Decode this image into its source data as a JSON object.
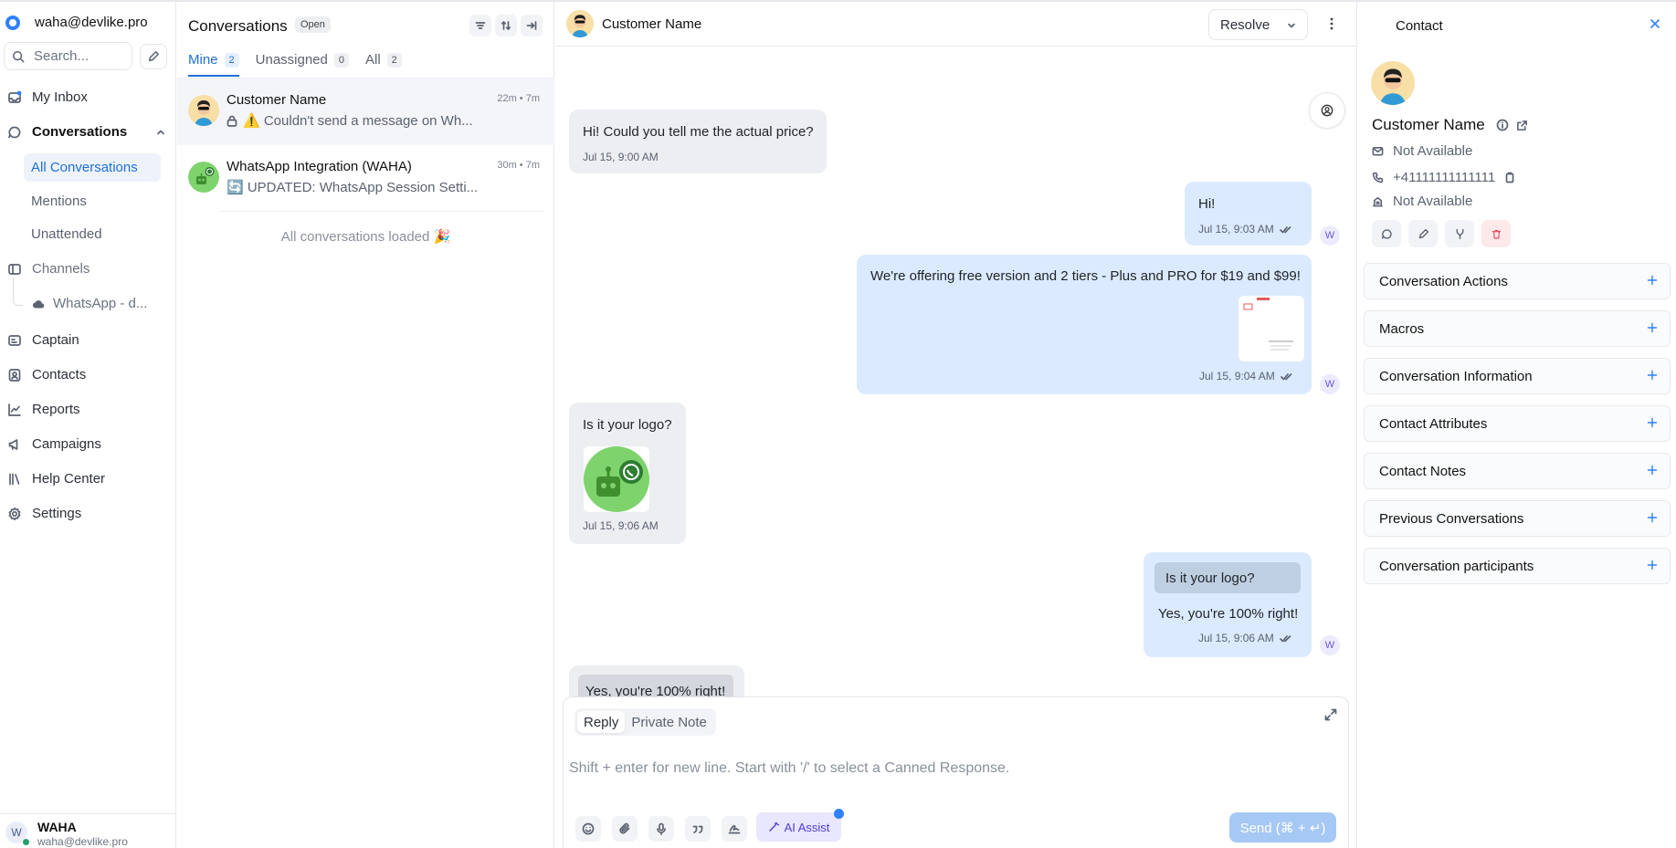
{
  "sidebar": {
    "account_name": "waha@devlike.pro",
    "search_placeholder": "Search...",
    "nav": {
      "my_inbox": "My Inbox",
      "conversations": "Conversations",
      "all_conversations": "All Conversations",
      "mentions": "Mentions",
      "unattended": "Unattended",
      "channels": "Channels",
      "channel_whatsapp": "WhatsApp - d...",
      "captain": "Captain",
      "contacts": "Contacts",
      "reports": "Reports",
      "campaigns": "Campaigns",
      "help_center": "Help Center",
      "settings": "Settings"
    },
    "user": {
      "initial": "W",
      "name": "WAHA",
      "email": "waha@devlike.pro"
    }
  },
  "conversation_list": {
    "title": "Conversations",
    "status_badge": "Open",
    "tabs": [
      {
        "label": "Mine",
        "count": "2"
      },
      {
        "label": "Unassigned",
        "count": "0"
      },
      {
        "label": "All",
        "count": "2"
      }
    ],
    "items": [
      {
        "name": "Customer Name",
        "time": "22m • 7m",
        "preview": "⚠️ Couldn't send a message on Wh..."
      },
      {
        "name": "WhatsApp Integration (WAHA)",
        "time": "30m • 7m",
        "preview": "🔄 UPDATED: WhatsApp Session Setti..."
      }
    ],
    "footer": "All conversations loaded 🎉"
  },
  "chat": {
    "contact_name": "Customer Name",
    "resolve_label": "Resolve",
    "messages": [
      {
        "text": "Hi! Could you tell me the actual price?",
        "time": "Jul 15, 9:00 AM"
      },
      {
        "text": "Hi!",
        "time": "Jul 15, 9:03 AM",
        "agent": "W"
      },
      {
        "text": "We're offering free version and 2 tiers - Plus and PRO for $19 and $99!",
        "time": "Jul 15, 9:04 AM",
        "agent": "W"
      },
      {
        "text": "Is it your logo?",
        "time": "Jul 15, 9:06 AM"
      },
      {
        "quoted": "Is it your logo?",
        "text": "Yes, you're 100% right!",
        "time": "Jul 15, 9:06 AM",
        "agent": "W"
      },
      {
        "quoted": "Yes, you're 100% right!"
      }
    ],
    "composer": {
      "mode_reply": "Reply",
      "mode_private": "Private Note",
      "placeholder": "Shift + enter for new line. Start with '/' to select a Canned Response.",
      "ai_assist": "AI Assist",
      "send": "Send (⌘ + ↵)"
    }
  },
  "contact_panel": {
    "title": "Contact",
    "name": "Customer Name",
    "email": "Not Available",
    "phone": "+41111111111111",
    "company": "Not Available",
    "sections": [
      "Conversation Actions",
      "Macros",
      "Conversation Information",
      "Contact Attributes",
      "Contact Notes",
      "Previous Conversations",
      "Conversation participants"
    ]
  },
  "colors": {
    "accent": "#1f6fd6",
    "outgoing_bubble": "#dbeafe",
    "incoming_bubble": "#eceef2",
    "send_button": "#a6c8f5"
  }
}
